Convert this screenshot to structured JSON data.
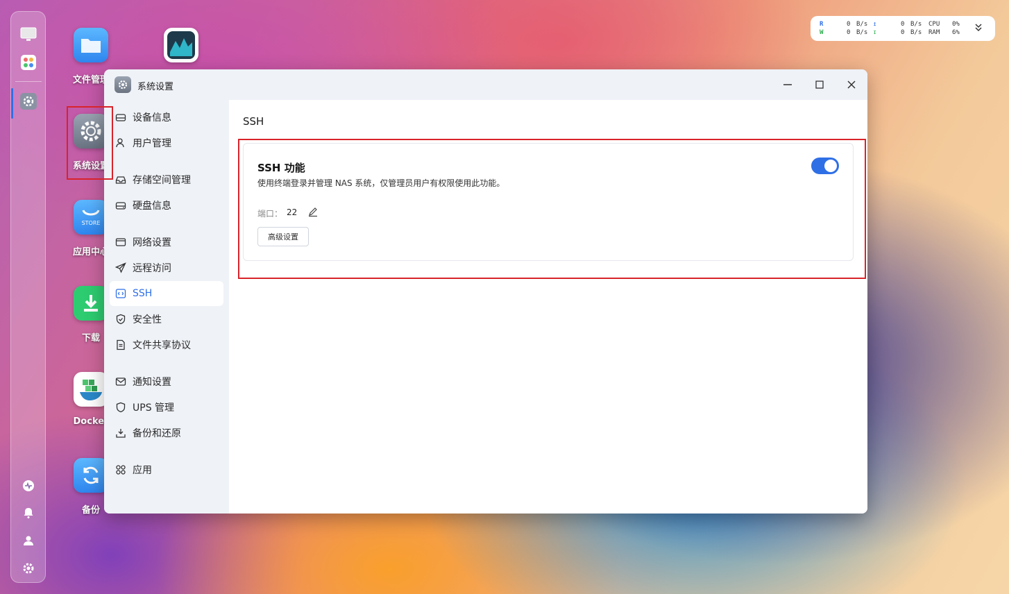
{
  "desktop": {
    "icons": [
      {
        "label": "文件管理",
        "icon": "folder-icon"
      },
      {
        "label": "",
        "icon": "resource-monitor-icon"
      },
      {
        "label": "系统设置",
        "icon": "settings-icon"
      },
      {
        "label": "应用中心",
        "icon": "store-icon",
        "tile_text": "STORE"
      },
      {
        "label": "下载",
        "icon": "download-icon"
      },
      {
        "label": "Docker",
        "icon": "docker-icon"
      },
      {
        "label": "备份",
        "icon": "backup-icon"
      }
    ]
  },
  "status_widget": {
    "read_label": "R",
    "write_label": "W",
    "read_rate": "0",
    "write_rate": "0",
    "unit": "B/s",
    "upload_rate": "0",
    "download_rate": "0",
    "cpu_label": "CPU",
    "cpu_value": "0%",
    "ram_label": "RAM",
    "ram_value": "6%"
  },
  "window": {
    "title": "系统设置",
    "nav": [
      {
        "label": "设备信息",
        "icon": "device-icon"
      },
      {
        "label": "用户管理",
        "icon": "user-icon"
      },
      {
        "label": "存储空间管理",
        "icon": "storage-icon"
      },
      {
        "label": "硬盘信息",
        "icon": "disk-icon"
      },
      {
        "label": "网络设置",
        "icon": "network-icon"
      },
      {
        "label": "远程访问",
        "icon": "send-icon"
      },
      {
        "label": "SSH",
        "icon": "code-icon",
        "active": true
      },
      {
        "label": "安全性",
        "icon": "shield-icon"
      },
      {
        "label": "文件共享协议",
        "icon": "document-icon"
      },
      {
        "label": "通知设置",
        "icon": "mail-icon"
      },
      {
        "label": "UPS 管理",
        "icon": "ups-icon"
      },
      {
        "label": "备份和还原",
        "icon": "backup-restore-icon"
      },
      {
        "label": "应用",
        "icon": "apps-grid-icon"
      }
    ],
    "content": {
      "page_title": "SSH",
      "card_title": "SSH 功能",
      "card_desc": "使用终端登录并管理 NAS 系统，仅管理员用户有权限使用此功能。",
      "toggle_on": true,
      "port_label": "端口：",
      "port_value": "22",
      "advanced_button": "高级设置"
    }
  },
  "colors": {
    "accent": "#2f6fe6",
    "highlight": "#d8232a"
  }
}
